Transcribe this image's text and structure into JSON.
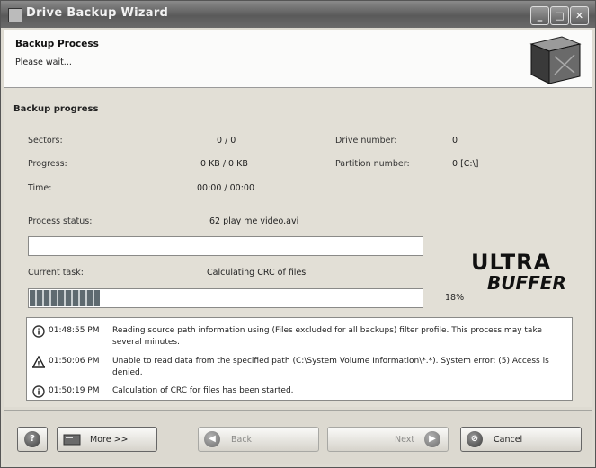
{
  "window": {
    "title": "Drive Backup Wizard",
    "title_buttons": [
      "_",
      "□",
      "✕"
    ]
  },
  "header": {
    "title": "Backup Process",
    "subtitle": "Please wait..."
  },
  "progress": {
    "section_title": "Backup progress",
    "sectors_label": "Sectors:",
    "sectors_value": "0 / 0",
    "progress_label": "Progress:",
    "progress_value": "0 KB / 0 KB",
    "time_label": "Time:",
    "time_value": "00:00 / 00:00",
    "drive_number_label": "Drive number:",
    "drive_number_value": "0",
    "partition_number_label": "Partition number:",
    "partition_number_value": "0 [C:\\]",
    "process_status_label": "Process status:",
    "process_status_value": "62 play me video.avi",
    "process_status_fraction": 0,
    "current_task_label": "Current task:",
    "current_task_value": "Calculating CRC of files",
    "task_percent_text": "18%",
    "task_fraction": 0.18
  },
  "logo": {
    "text_top": "ULTRA",
    "text_bottom": "BUFFER"
  },
  "log": [
    {
      "icon": "info-icon",
      "time": "01:48:55 PM",
      "message": "Reading source path information using (Files excluded for all backups) filter profile. This process may take several minutes."
    },
    {
      "icon": "warning-icon",
      "time": "01:50:06 PM",
      "message": "Unable to read data from the specified path (C:\\System Volume Information\\*.*). System error: (5) Access is denied."
    },
    {
      "icon": "info-icon",
      "time": "01:50:19 PM",
      "message": "Calculation of CRC for files has been started."
    }
  ],
  "footer": {
    "help_label": "?",
    "more_label": "More >>",
    "back_label": "Back",
    "next_label": "Next",
    "cancel_label": "Cancel"
  }
}
